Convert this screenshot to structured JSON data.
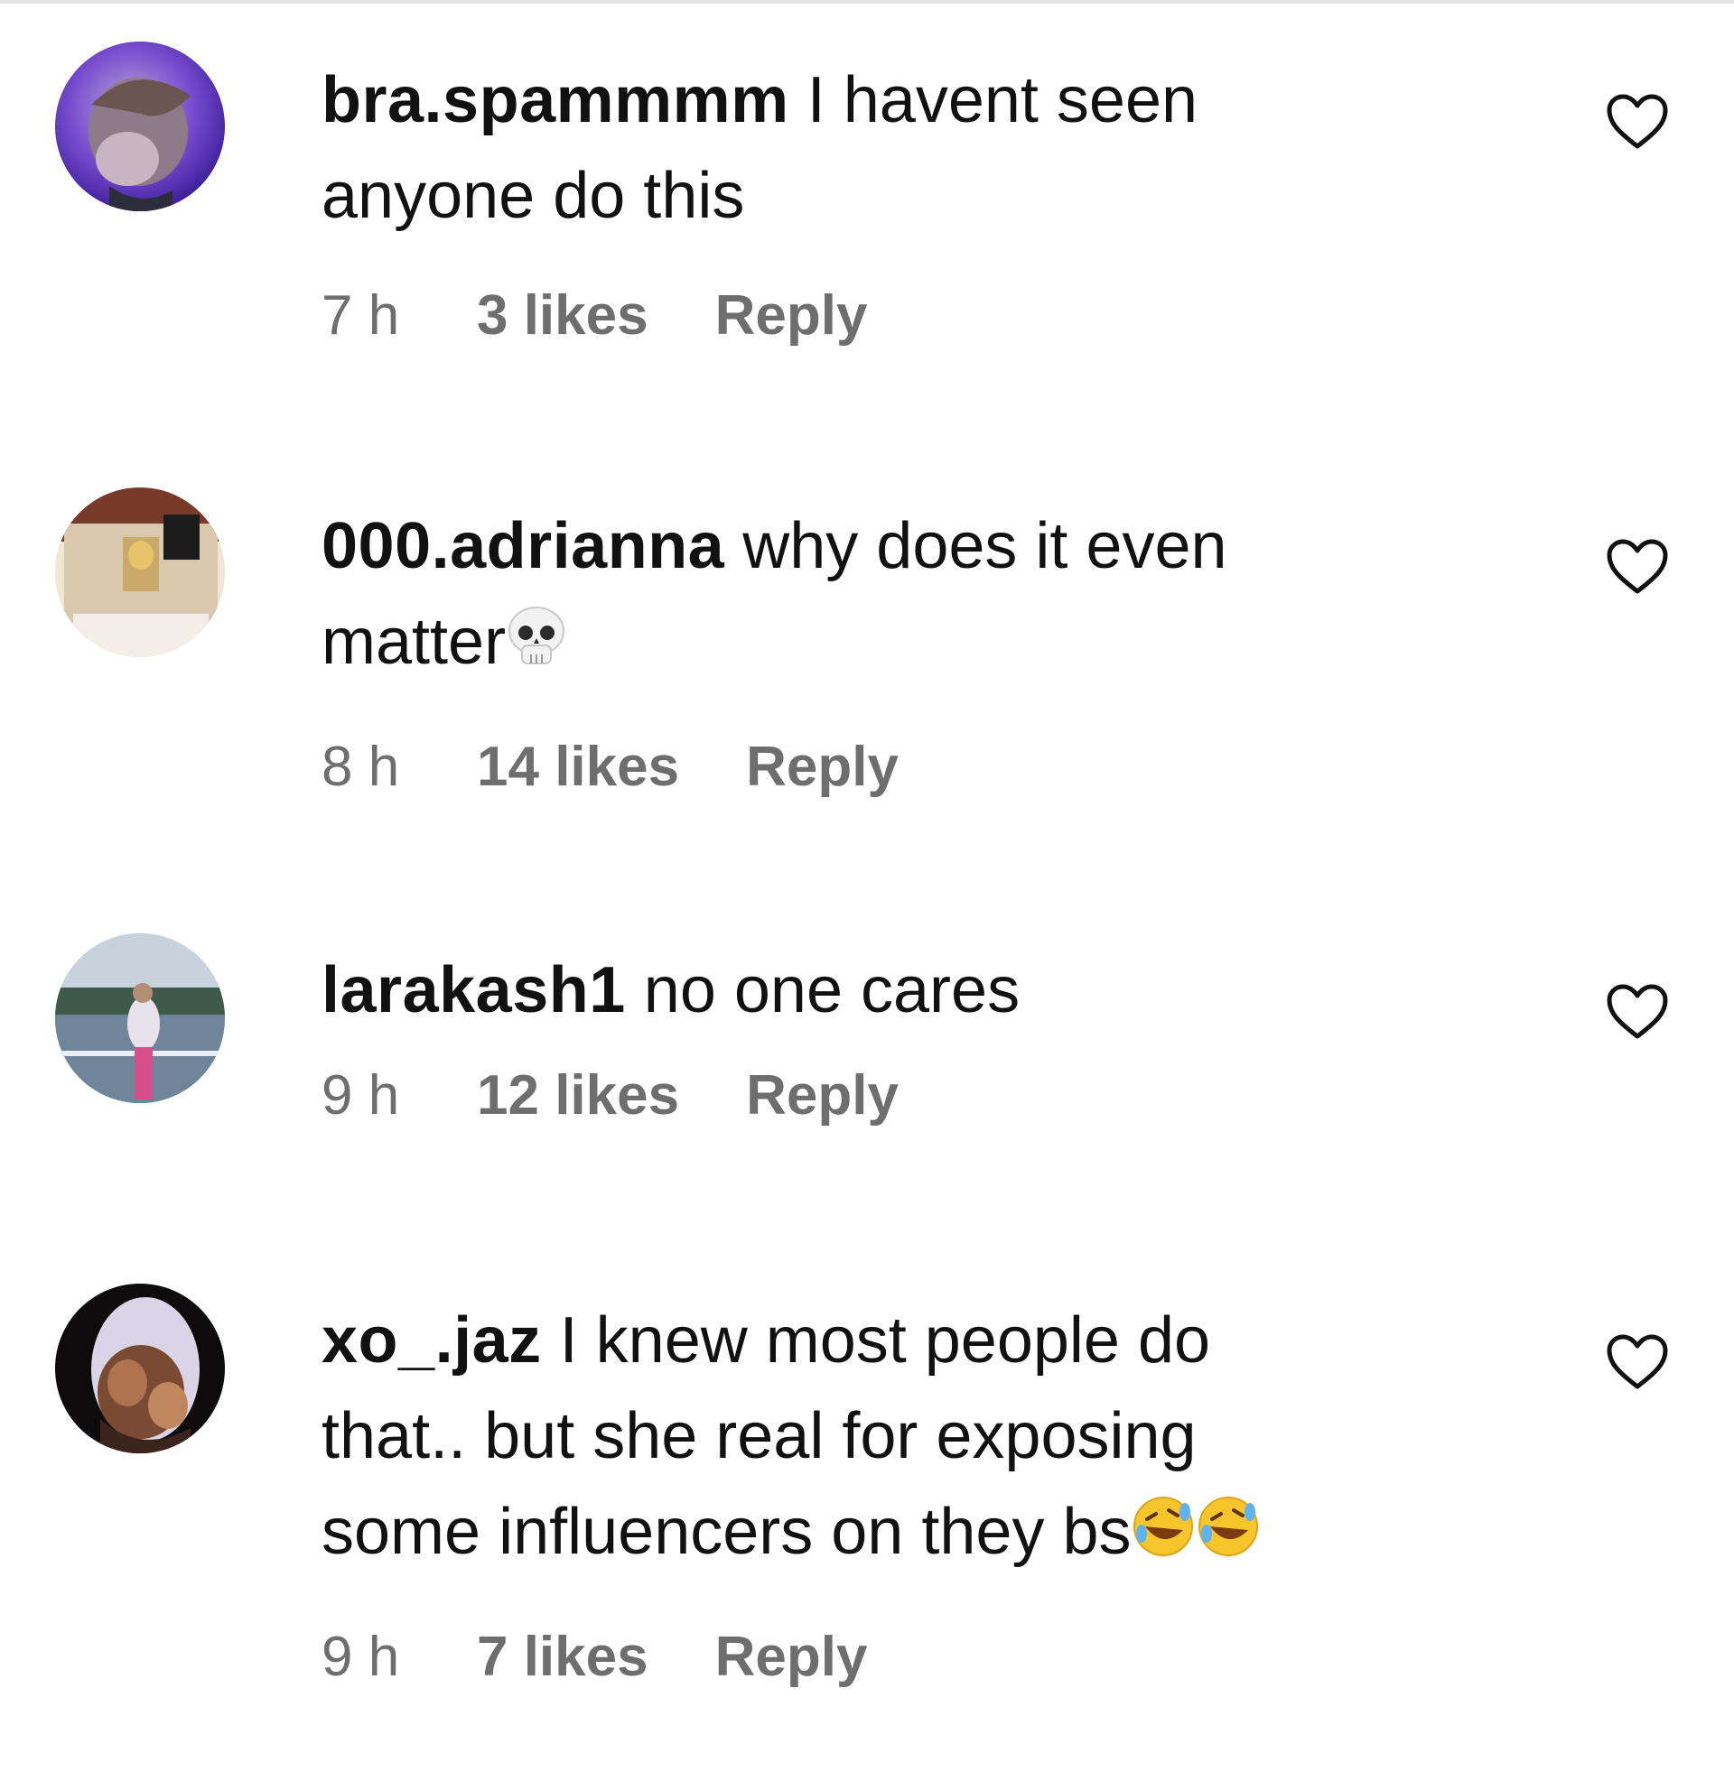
{
  "comments": [
    {
      "username": "bra.spammmm",
      "text_lines": [
        "I havent seen",
        "anyone do this"
      ],
      "time": "7 h",
      "likes": "3 likes",
      "reply": "Reply",
      "emoji": []
    },
    {
      "username": "000.adrianna",
      "text_lines": [
        "why does it even",
        "matter"
      ],
      "time": "8 h",
      "likes": "14 likes",
      "reply": "Reply",
      "emoji": [
        "skull"
      ]
    },
    {
      "username": "larakash1",
      "text_lines": [
        "no one cares"
      ],
      "time": "9 h",
      "likes": "12 likes",
      "reply": "Reply",
      "emoji": []
    },
    {
      "username": "xo_.jaz",
      "text_lines": [
        "I knew most people do",
        "that.. but she real for exposing",
        "some influencers on they bs"
      ],
      "time": "9 h",
      "likes": "7 likes",
      "reply": "Reply",
      "emoji": [
        "rolling-on-floor-laughing",
        "rolling-on-floor-laughing"
      ]
    }
  ],
  "icons": {
    "like": "heart-outline-icon"
  },
  "colors": {
    "text": "#111111",
    "meta": "#6e6e6e",
    "divider": "#e6e6e6"
  }
}
